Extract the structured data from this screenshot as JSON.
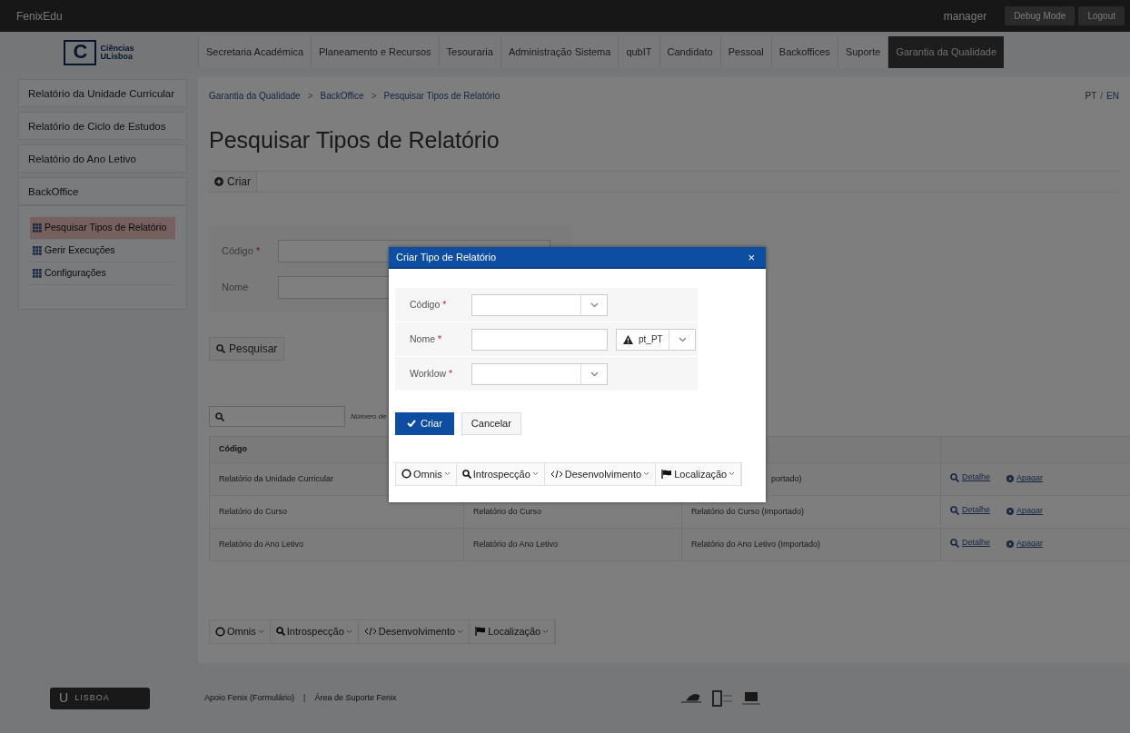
{
  "topbar": {
    "brand": "FenixEdu",
    "user": "manager",
    "buttons": [
      "Debug Mode",
      "Logout"
    ]
  },
  "required_mark": "*",
  "logo": {
    "letter": "C",
    "lines": [
      "Ciências",
      "ULisboa"
    ]
  },
  "nav_tabs": [
    {
      "label": "Secretaria Académica",
      "selected": false
    },
    {
      "label": "Planeamento e Recursos",
      "selected": false
    },
    {
      "label": "Tesouraria",
      "selected": false
    },
    {
      "label": "Administração Sistema",
      "selected": false
    },
    {
      "label": "qubIT",
      "selected": false
    },
    {
      "label": "Candidato",
      "selected": false
    },
    {
      "label": "Pessoal",
      "selected": false
    },
    {
      "label": "Backoffices",
      "selected": false
    },
    {
      "label": "Suporte",
      "selected": false
    },
    {
      "label": "Garantia da Qualidade",
      "selected": true
    }
  ],
  "sidebar": {
    "items": [
      {
        "label": "Relatório da Unidade Curricular"
      },
      {
        "label": "Relatório de Ciclo de Estudos"
      },
      {
        "label": "Relatório do Ano Letivo"
      }
    ],
    "section": {
      "label": "BackOffice",
      "children": [
        {
          "label": "Pesquisar Tipos de Relatório",
          "selected": true
        },
        {
          "label": "Gerir Execuções",
          "selected": false
        },
        {
          "label": "Configurações",
          "selected": false
        }
      ]
    }
  },
  "breadcrumb": {
    "items": [
      "Garantia da Qualidade",
      "BackOffice",
      "Pesquisar Tipos de Relatório"
    ],
    "separator": ">"
  },
  "languages": {
    "items": [
      "PT",
      "EN"
    ],
    "separator": "/"
  },
  "title": "Pesquisar Tipos de Relatório",
  "create_button": "Criar",
  "search_form": {
    "fields": [
      {
        "label": "Código",
        "required": true
      },
      {
        "label": "Nome",
        "required": false
      }
    ],
    "submit": "Pesquisar"
  },
  "table_filter": {
    "hint": "Número de"
  },
  "table": {
    "columns": [
      "Código"
    ],
    "rows": [
      {
        "column_1": "Relatório da Unidade Curricular",
        "column_3": "portado)",
        "actions": [
          "Detalhe",
          "Apagar"
        ]
      },
      {
        "column_1": "Relatório do Curso",
        "column_2": "Relatório do Curso",
        "column_3": "Relatório do Curso (Importado)",
        "actions": [
          "Detalhe",
          "Apagar"
        ]
      },
      {
        "column_1": "Relatório do Ano Letivo",
        "column_2": "Relatório do Ano Letivo",
        "column_3": "Relatório do Ano Letivo (Importado)",
        "actions": [
          "Detalhe",
          "Apagar"
        ]
      }
    ]
  },
  "page_toolbar": [
    {
      "label": "Omnis",
      "kind": "circle"
    },
    {
      "label": "Introspecção",
      "kind": "search"
    },
    {
      "label": "Desenvolvimento",
      "kind": "code"
    },
    {
      "label": "Localização",
      "kind": "flag"
    }
  ],
  "footer": {
    "logo_letter": "U",
    "logo_text": "LISBOA",
    "links": [
      "Apoio Fenix (Formulário)",
      "Área de Suporte Fenix"
    ],
    "separator": "|"
  },
  "modal": {
    "title": "Criar Tipo de Relatório",
    "close": "×",
    "fields": [
      {
        "label": "Código",
        "required": true,
        "kind": "select"
      },
      {
        "label": "Nome",
        "required": true,
        "kind": "localized",
        "locale": "pt_PT"
      },
      {
        "label": "Worklow",
        "required": true,
        "kind": "select"
      }
    ],
    "submit": "Criar",
    "cancel": "Cancelar",
    "toolbar": [
      {
        "label": "Omnis",
        "kind": "circle"
      },
      {
        "label": "Introspecção",
        "kind": "search"
      },
      {
        "label": "Desenvolvimento",
        "kind": "code"
      },
      {
        "label": "Localização",
        "kind": "flag"
      }
    ]
  }
}
